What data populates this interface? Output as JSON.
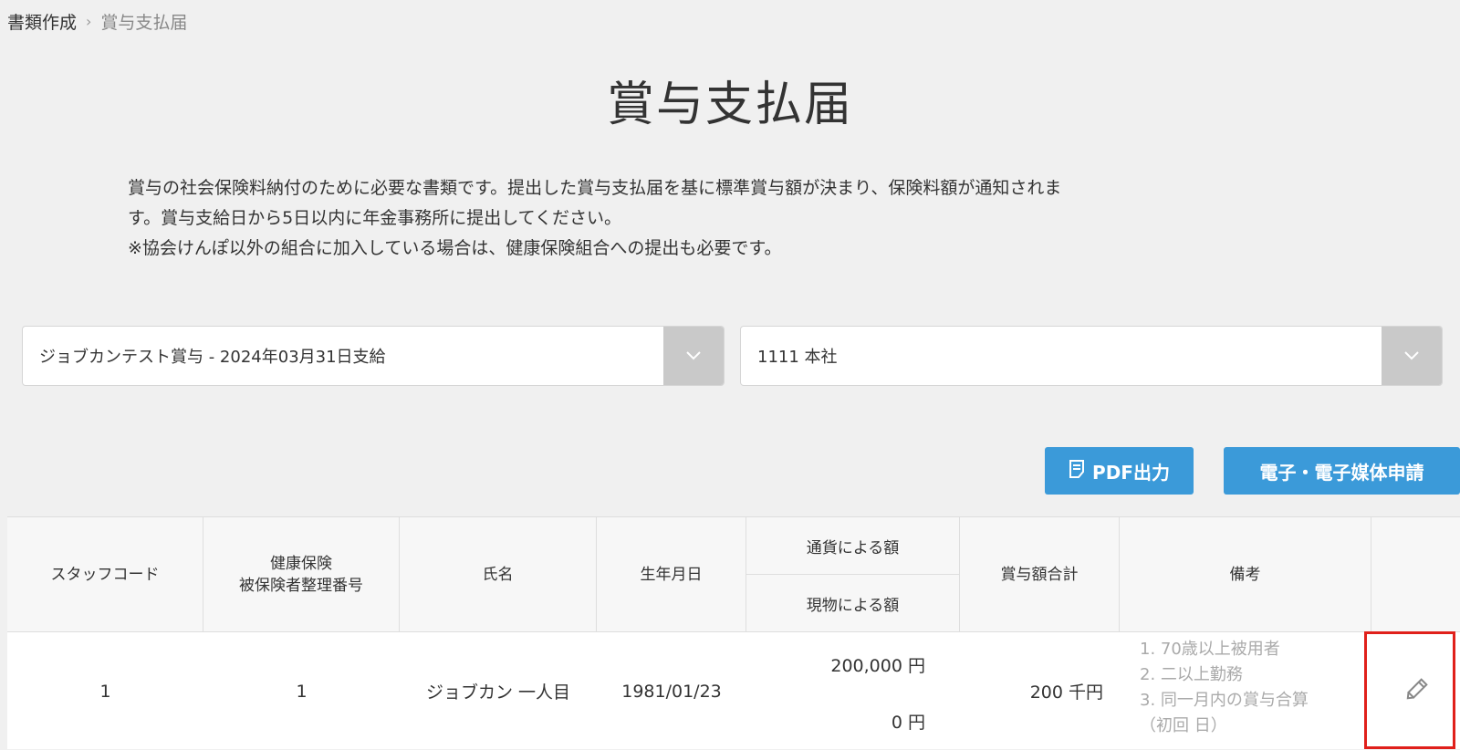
{
  "breadcrumb": {
    "parent": "書類作成",
    "separator": "›",
    "current": "賞与支払届"
  },
  "page": {
    "title": "賞与支払届",
    "description_lines": [
      "賞与の社会保険料納付のために必要な書類です。提出した賞与支払届を基に標準賞与額が決まり、保険料額が通知されま",
      "す。賞与支給日から5日以内に年金事務所に提出してください。",
      "※協会けんぽ以外の組合に加入している場合は、健康保険組合への提出も必要です。"
    ]
  },
  "filters": {
    "bonus_select": {
      "value": "ジョブカンテスト賞与 - 2024年03月31日支給",
      "icon": "chevron-down-icon"
    },
    "office_select": {
      "value": "1111 本社",
      "icon": "chevron-down-icon"
    }
  },
  "actions": {
    "pdf_label": "PDF出力",
    "pdf_icon": "document-icon",
    "electronic_label": "電子・電子媒体申請"
  },
  "table": {
    "headers": {
      "staff_code": "スタッフコード",
      "insured_number_line1": "健康保険",
      "insured_number_line2": "被保険者整理番号",
      "name": "氏名",
      "birthdate": "生年月日",
      "currency_amount": "通貨による額",
      "in_kind_amount": "現物による額",
      "bonus_total": "賞与額合計",
      "notes": "備考"
    },
    "rows": [
      {
        "staff_code": "1",
        "insured_number": "1",
        "name": "ジョブカン 一人目",
        "birthdate": "1981/01/23",
        "currency_amount": "200,000 円",
        "in_kind_amount": "0 円",
        "bonus_total": "200 千円",
        "notes": [
          "1. 70歳以上被用者",
          "2. 二以上勤務",
          "3. 同一月内の賞与合算",
          "（初回 日）"
        ],
        "edit_icon": "pencil-icon"
      }
    ]
  },
  "colors": {
    "background": "#f0f0f0",
    "primary_button": "#3b9ad9",
    "highlight": "#e0201b",
    "muted_text": "#aaaaaa"
  }
}
